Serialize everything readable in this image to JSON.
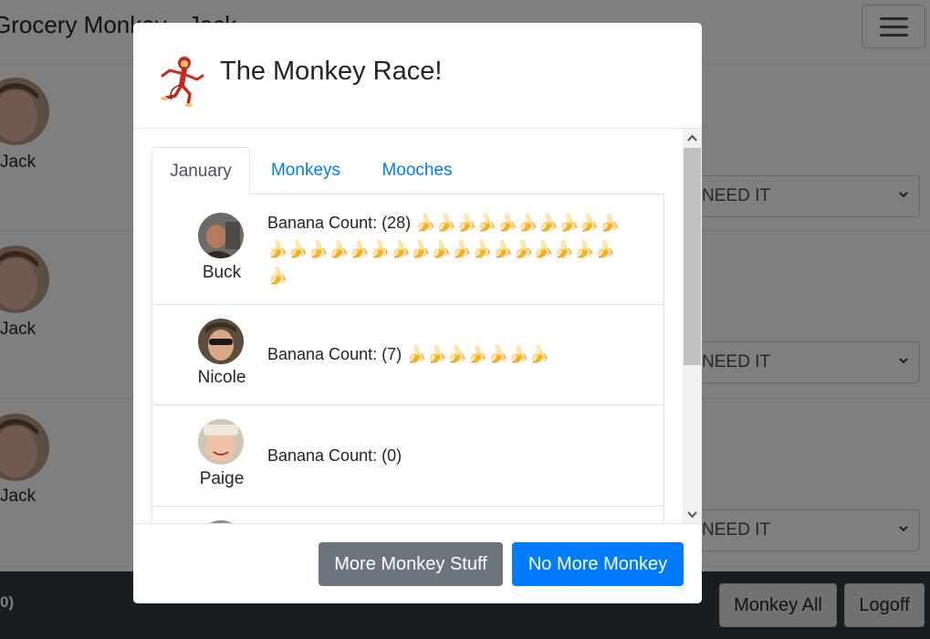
{
  "app": {
    "title": "Grocery Monkey - Jack",
    "menu_icon": "hamburger-icon"
  },
  "rows": [
    {
      "name": "Jack",
      "status": "NEED IT"
    },
    {
      "name": "Jack",
      "status": "NEED IT"
    },
    {
      "name": "Jack",
      "status": "NEED IT"
    }
  ],
  "footer": {
    "count": "0)",
    "monkey_all_label": "Monkey All",
    "logoff_label": "Logoff"
  },
  "modal": {
    "title": "The Monkey Race!",
    "logo_icon": "running-monkey-icon",
    "tabs": [
      {
        "label": "January",
        "active": true
      },
      {
        "label": "Monkeys",
        "active": false
      },
      {
        "label": "Mooches",
        "active": false
      }
    ],
    "leaderboard": [
      {
        "name": "Buck",
        "count_label": "Banana Count: (28)",
        "bananas": "🍌🍌🍌🍌🍌🍌🍌🍌🍌🍌🍌🍌🍌🍌🍌🍌🍌🍌🍌🍌🍌🍌🍌🍌🍌🍌🍌🍌"
      },
      {
        "name": "Nicole",
        "count_label": "Banana Count: (7)",
        "bananas": "🍌🍌🍌🍌🍌🍌🍌"
      },
      {
        "name": "Paige",
        "count_label": "Banana Count: (0)",
        "bananas": ""
      }
    ],
    "buttons": {
      "secondary": "More Monkey Stuff",
      "primary": "No More Monkey"
    }
  },
  "colors": {
    "primary": "#007bff",
    "secondary": "#6c757d",
    "dark": "#343a40",
    "overlay": "rgba(0,0,0,0.5)"
  }
}
